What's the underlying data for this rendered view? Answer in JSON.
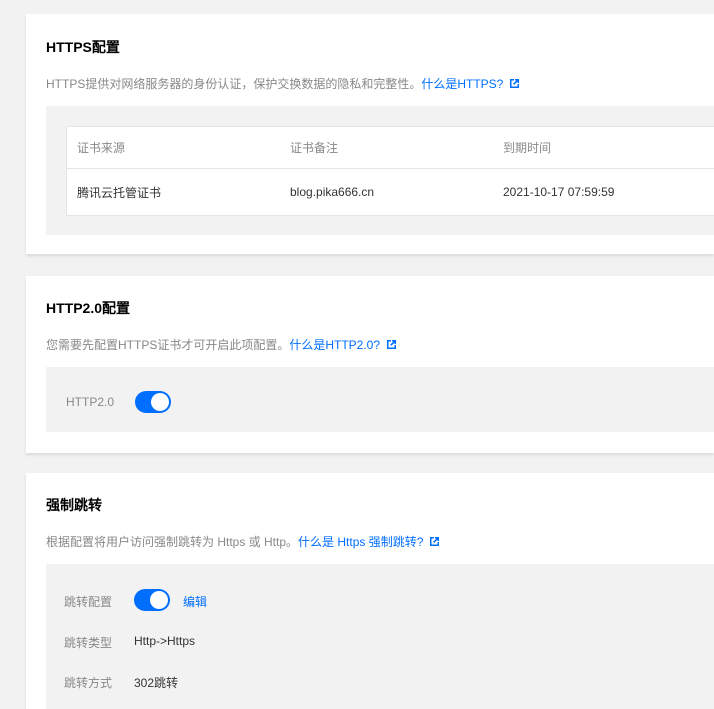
{
  "https": {
    "title": "HTTPS配置",
    "desc": "HTTPS提供对网络服务器的身份认证，保护交换数据的隐私和完整性。",
    "link": "什么是HTTPS?",
    "table": {
      "headers": [
        "证书来源",
        "证书备注",
        "到期时间"
      ],
      "rows": [
        [
          "腾讯云托管证书",
          "blog.pika666.cn",
          "2021-10-17 07:59:59"
        ]
      ]
    }
  },
  "http2": {
    "title": "HTTP2.0配置",
    "desc": "您需要先配置HTTPS证书才可开启此项配置。",
    "link": "什么是HTTP2.0?",
    "switch_label": "HTTP2.0",
    "switch_on": true
  },
  "redirect": {
    "title": "强制跳转",
    "desc": "根据配置将用户访问强制跳转为 Https 或 Http。",
    "link": "什么是 Https 强制跳转?",
    "config_label": "跳转配置",
    "config_on": true,
    "edit_label": "编辑",
    "type_label": "跳转类型",
    "type_value": "Http->Https",
    "method_label": "跳转方式",
    "method_value": "302跳转"
  },
  "colors": {
    "accent": "#006eff",
    "page_bg": "#f2f2f2",
    "muted_text": "#888888"
  }
}
